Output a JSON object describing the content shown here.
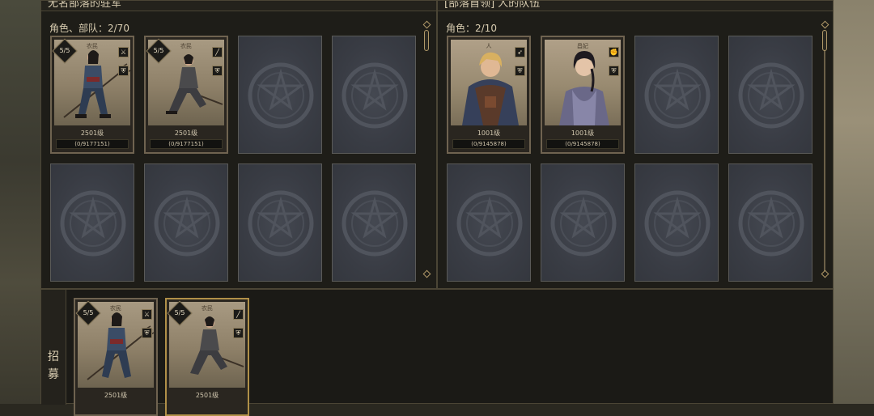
{
  "left_panel": {
    "title": "无名部落的驻军",
    "count_label": "角色、部队：2/70",
    "cards": [
      {
        "name": "农民",
        "stars": "5/5",
        "level": "2501级",
        "exp": "(0/9177151)",
        "icons": [
          "sword-icon",
          "shield-icon"
        ]
      },
      {
        "name": "农民",
        "stars": "5/5",
        "level": "2501级",
        "exp": "(0/9177151)",
        "icons": [
          "spear-icon",
          "shield-icon"
        ]
      }
    ]
  },
  "right_panel": {
    "title": "[部落首领] 人的队伍",
    "count_label": "角色：2/10",
    "cards": [
      {
        "name": "人",
        "level": "1001级",
        "exp": "(0/9145878)",
        "icons": [
          "bow-icon",
          "shield-icon"
        ]
      },
      {
        "name": "昌妃",
        "level": "1001级",
        "exp": "(0/9145878)",
        "icons": [
          "fist-icon",
          "shield-icon"
        ]
      }
    ]
  },
  "recruit_panel": {
    "tab_label": "招募",
    "cards": [
      {
        "name": "农民",
        "stars": "5/5",
        "level": "2501级",
        "icons": [
          "sword-icon",
          "shield-icon"
        ]
      },
      {
        "name": "农民",
        "stars": "5/5",
        "level": "2501级",
        "icons": [
          "spear-icon",
          "shield-icon"
        ]
      }
    ]
  },
  "colors": {
    "panel": "#1e1d18",
    "border": "#4b4535",
    "slot": "#3a3d45",
    "gold": "#b09048",
    "text": "#d8ccb0"
  }
}
